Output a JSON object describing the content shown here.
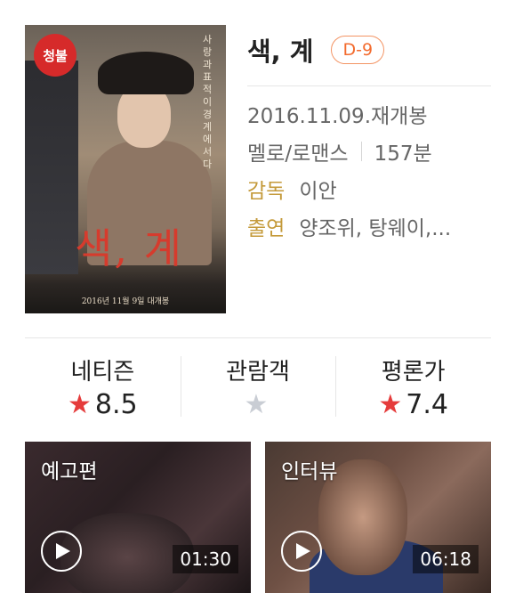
{
  "movie": {
    "age_rating": "청불",
    "title": "색, 계",
    "d_day": "D-9",
    "release": "2016.11.09.재개봉",
    "genre": "멜로/로맨스",
    "runtime": "157분",
    "director_label": "감독",
    "director": "이안",
    "cast_label": "출연",
    "cast": "양조위, 탕웨이,..."
  },
  "poster": {
    "title_art": "색, 계",
    "vertical_text": "사랑과 표적이 경계에 서다",
    "release_text": "2016년 11월 9일 대개봉"
  },
  "scores": [
    {
      "label": "네티즌",
      "value": "8.5",
      "filled": true
    },
    {
      "label": "관람객",
      "value": "",
      "filled": false
    },
    {
      "label": "평론가",
      "value": "7.4",
      "filled": true
    }
  ],
  "videos": [
    {
      "label": "예고편",
      "duration": "01:30"
    },
    {
      "label": "인터뷰",
      "duration": "06:18"
    }
  ],
  "colors": {
    "accent_gold": "#c49a3a",
    "dday_orange": "#f36b2e",
    "star_red": "#e53b3b",
    "star_empty": "#c9cdd4",
    "rating_red": "#d62a2a"
  }
}
